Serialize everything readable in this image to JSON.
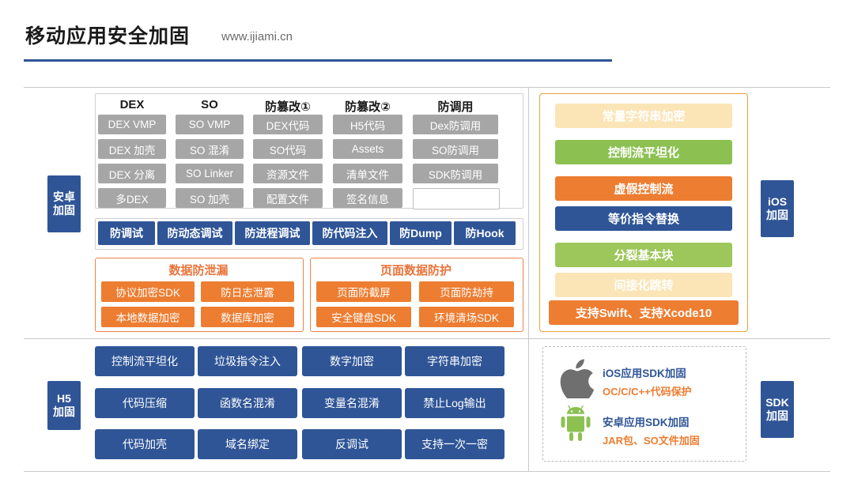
{
  "header": {
    "title": "移动应用安全加固",
    "site": "www.ijiami.cn"
  },
  "left_labels": {
    "android": "安卓\n加固",
    "h5": "H5\n加固"
  },
  "right_labels": {
    "ios": "iOS\n加固",
    "sdk": "SDK\n加固"
  },
  "columns": [
    {
      "head": "DEX",
      "items": [
        {
          "label": "DEX VMP",
          "style": "gray"
        },
        {
          "label": "DEX 加壳",
          "style": "gray"
        },
        {
          "label": "DEX 分离",
          "style": "gray"
        },
        {
          "label": "多DEX",
          "style": "gray"
        }
      ]
    },
    {
      "head": "SO",
      "items": [
        {
          "label": "SO VMP",
          "style": "gray"
        },
        {
          "label": "SO 混淆",
          "style": "gray"
        },
        {
          "label": "SO Linker",
          "style": "gray"
        },
        {
          "label": "SO 加壳",
          "style": "gray"
        }
      ]
    },
    {
      "head": "防篡改①",
      "items": [
        {
          "label": "DEX代码",
          "style": "gray"
        },
        {
          "label": "SO代码",
          "style": "gray"
        },
        {
          "label": "资源文件",
          "style": "gray"
        },
        {
          "label": "配置文件",
          "style": "gray"
        }
      ]
    },
    {
      "head": "防篡改②",
      "items": [
        {
          "label": "H5代码",
          "style": "gray"
        },
        {
          "label": "Assets",
          "style": "gray"
        },
        {
          "label": "清单文件",
          "style": "gray"
        },
        {
          "label": "签名信息",
          "style": "gray"
        }
      ]
    },
    {
      "head": "防调用",
      "items": [
        {
          "label": "Dex防调用",
          "style": "gray"
        },
        {
          "label": "SO防调用",
          "style": "gray"
        },
        {
          "label": "SDK防调用",
          "style": "gray"
        },
        {
          "label": "",
          "style": "white"
        }
      ]
    }
  ],
  "antidebug": {
    "items": [
      "防调试",
      "防动态调试",
      "防进程调试",
      "防代码注入",
      "防Dump",
      "防Hook"
    ]
  },
  "orange_panels": [
    {
      "title": "数据防泄漏",
      "items": [
        "协议加密SDK",
        "防日志泄露",
        "本地数据加密",
        "数据库加密"
      ]
    },
    {
      "title": "页面数据防护",
      "items": [
        "页面防截屏",
        "页面防劫持",
        "安全键盘SDK",
        "环境清场SDK"
      ]
    }
  ],
  "ios_panel": {
    "items": [
      {
        "label": "常量字符串加密",
        "color": "#fbe5b6",
        "text": "#ffffff"
      },
      {
        "label": "控制流平坦化",
        "color": "#8cc152",
        "text": "#ffffff"
      },
      {
        "label": "虚假控制流",
        "color": "#ed7d31",
        "text": "#ffffff"
      },
      {
        "label": "等价指令替换",
        "color": "#2f5597",
        "text": "#ffffff"
      },
      {
        "label": "分裂基本块",
        "color": "#9dc75a",
        "text": "#ffffff"
      },
      {
        "label": "间接化跳转",
        "color": "#fbe5b6",
        "text": "#ffffff"
      },
      {
        "label": "支持Swift、支持Xcode10",
        "color": "#ed7d31",
        "text": "#ffffff"
      }
    ]
  },
  "h5_buttons": [
    "控制流平坦化",
    "垃圾指令注入",
    "数字加密",
    "字符串加密",
    "代码压缩",
    "函数名混淆",
    "变量名混淆",
    "禁止Log输出",
    "代码加壳",
    "域名绑定",
    "反调试",
    "支持一次一密"
  ],
  "sdk_panel": {
    "rows": [
      {
        "icon": "apple-icon",
        "title": "iOS应用SDK加固",
        "sub": "OC/C/C++代码保护"
      },
      {
        "icon": "android-icon",
        "title": "安卓应用SDK加固",
        "sub": "JAR包、SO文件加固"
      }
    ]
  }
}
